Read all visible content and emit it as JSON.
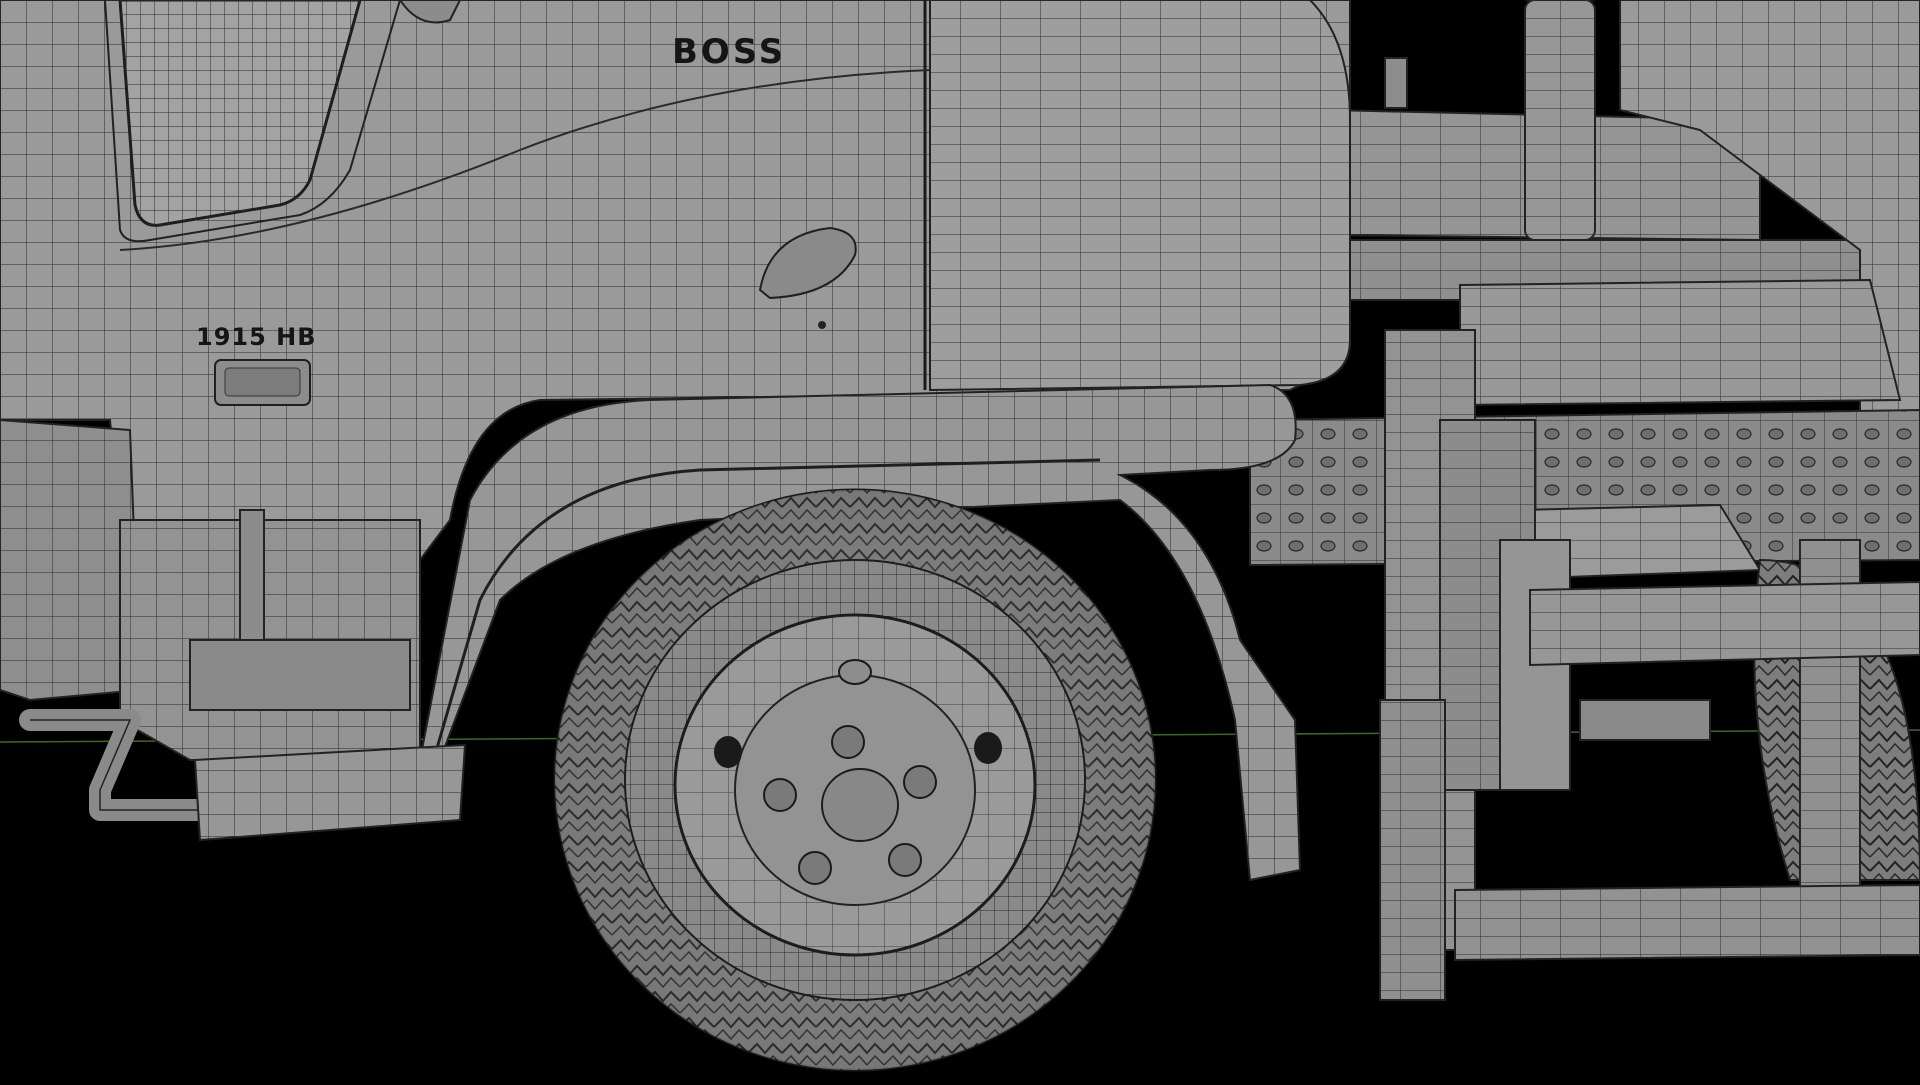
{
  "scene": {
    "brand_badge": "BOSS",
    "model_badge": "1915 HB",
    "colors": {
      "background": "#000000",
      "shading": "#8e8e8e",
      "wire": "#1e1e1e",
      "ground_line": "#3a6a22"
    }
  }
}
